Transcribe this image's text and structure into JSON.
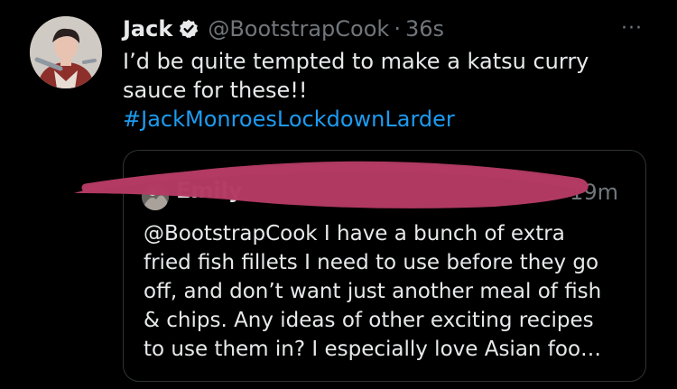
{
  "tweet": {
    "author_name": "Jack",
    "handle": "@BootstrapCook",
    "separator": "·",
    "time": "36s",
    "more_icon": "···",
    "text_lines": [
      "I’d be quite tempted to make a katsu curry",
      "sauce for these!!"
    ],
    "hashtag": "#JackMonroesLockdownLarder"
  },
  "quoted_tweet": {
    "author_name": "Emily",
    "time": "19m",
    "text_lines": [
      "@BootstrapCook I have a bunch of extra",
      "fried fish fillets I need to use before they go",
      "off, and don’t want just another meal of fish",
      "& chips. Any ideas of other exciting recipes",
      "to use them in? I especially love Asian foo…"
    ]
  },
  "colors": {
    "background": "#000000",
    "text": "#e7e9ea",
    "muted": "#71767b",
    "link": "#1d9bf0",
    "verified": "#e7e9ea",
    "border": "#2f3336",
    "redaction": "#b23a63"
  },
  "icons": {
    "verified": "verified-badge-icon",
    "more": "more-horizontal-icon"
  }
}
